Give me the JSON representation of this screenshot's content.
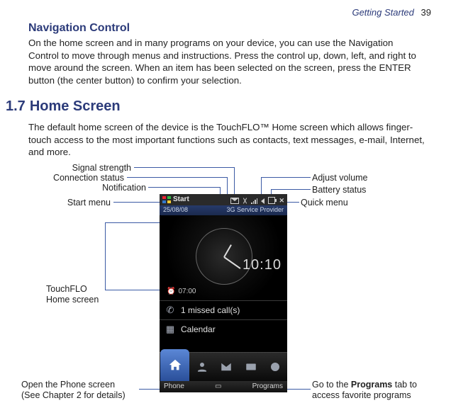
{
  "page": {
    "header_title": "Getting Started",
    "page_number": "39"
  },
  "nav_control": {
    "title": "Navigation Control",
    "body": "On the home screen and in many programs on your device, you can use the Navigation Control to move through menus and instructions. Press the control up, down, left, and right to move around the screen. When an item has been selected on the screen, press the ENTER button (the center button) to confirm your selection."
  },
  "home_screen": {
    "number": "1.7",
    "title": "Home Screen",
    "body": "The default home screen of the device is the TouchFLO™ Home screen which allows finger-touch access to the most important functions such as contacts, text messages, e-mail, Internet, and more."
  },
  "labels": {
    "signal_strength": "Signal strength",
    "connection_status": "Connection status",
    "notification": "Notification",
    "start_menu": "Start menu",
    "touchflo_line1": "TouchFLO",
    "touchflo_line2": "Home screen",
    "open_phone_line1": "Open the Phone screen",
    "open_phone_line2": "(See Chapter 2 for details)",
    "adjust_volume": "Adjust volume",
    "battery_status": "Battery status",
    "quick_menu": "Quick menu",
    "go_programs_prefix": "Go to the ",
    "go_programs_bold": "Programs",
    "go_programs_suffix": " tab to",
    "go_programs_line2": "access favorite programs"
  },
  "phone": {
    "start": "Start",
    "date": "25/08/08",
    "carrier": "3G Service Provider",
    "time": "10:10",
    "alarm": "07:00",
    "missed": "1 missed call(s)",
    "calendar": "Calendar",
    "softleft": "Phone",
    "softright": "Programs"
  }
}
